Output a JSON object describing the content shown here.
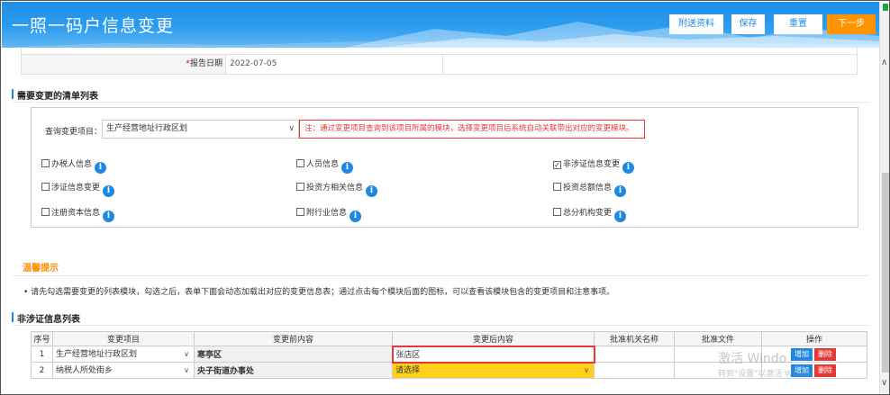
{
  "header": {
    "title": "一照一码户信息变更",
    "buttons": {
      "attach": "附送资料",
      "save": "保存",
      "reset": "重置",
      "next": "下一步"
    }
  },
  "form": {
    "report_date_label": "报告日期",
    "report_date_required": "*",
    "report_date_value": "2022-07-05"
  },
  "change_list": {
    "section_title": "需要变更的清单列表",
    "query_label": "查询变更项目：",
    "query_value": "生产经营地址行政区划",
    "query_note": "注：通过变更项目查询到该项目所属的模块，选择变更项目后系统自动关联带出对应的变更模块。",
    "checkboxes": [
      {
        "label": "办税人信息",
        "checked": false
      },
      {
        "label": "人员信息",
        "checked": false
      },
      {
        "label": "非涉证信息变更",
        "checked": true
      },
      {
        "label": "涉证信息变更",
        "checked": false
      },
      {
        "label": "投资方相关信息",
        "checked": false
      },
      {
        "label": "投资总额信息",
        "checked": false
      },
      {
        "label": "注册资本信息",
        "checked": false
      },
      {
        "label": "附行业信息",
        "checked": false
      },
      {
        "label": "总分机构变更",
        "checked": false
      }
    ],
    "checked_mark": "☑",
    "info_glyph": "i"
  },
  "tips": {
    "title": "温馨提示",
    "text": "• 请先勾选需要变更的列表模块，勾选之后，表单下面会动态加载出对应的变更信息表；通过点击每个模块后面的图标，可以查看该模块包含的变更项目和注意事项。"
  },
  "non_cert_table": {
    "section_title": "非涉证信息列表",
    "headers": [
      "序号",
      "变更项目",
      "变更前内容",
      "变更后内容",
      "批准机关名称",
      "批准文件",
      "操作"
    ],
    "rows": [
      {
        "no": "1",
        "item": "生产经营地址行政区划",
        "before": "寒亭区",
        "after": "张店区",
        "approver": "",
        "doc": "",
        "add": "增加",
        "del": "删除"
      },
      {
        "no": "2",
        "item": "纳税人所处街乡",
        "before": "央子街道办事处",
        "after": "请选择",
        "approver": "",
        "doc": "",
        "add": "增加",
        "del": "删除"
      }
    ]
  },
  "watermark": {
    "line1": "激活 Windo",
    "line2": "转到\"设置\"以激活 Windo"
  },
  "colors": {
    "accent": "#1e88e5",
    "next_button": "#ff9400",
    "highlight": "#ffd11a",
    "alert": "#e53935",
    "tips_title": "#ff8c00"
  }
}
